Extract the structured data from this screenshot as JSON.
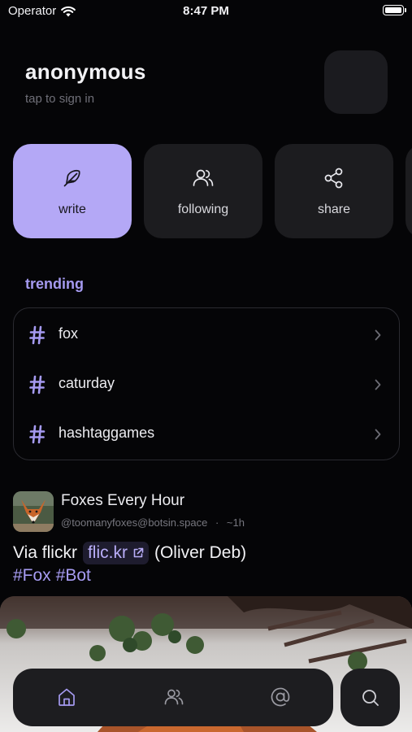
{
  "status_bar": {
    "carrier": "Operator",
    "time": "8:47 PM"
  },
  "profile": {
    "name": "anonymous",
    "subtitle": "tap to sign in"
  },
  "actions": [
    {
      "label": "write",
      "icon": "feather-icon",
      "active": true
    },
    {
      "label": "following",
      "icon": "users-icon",
      "active": false
    },
    {
      "label": "share",
      "icon": "share-icon",
      "active": false
    }
  ],
  "trending": {
    "title": "trending",
    "tags": [
      "fox",
      "caturday",
      "hashtaggames"
    ]
  },
  "post": {
    "author": "Foxes Every Hour",
    "handle": "@toomanyfoxes@botsin.space",
    "separator": "·",
    "time": "~1h",
    "text_prefix": "Via flickr",
    "link": "flic.kr",
    "text_suffix": "(Oliver Deb)",
    "tags": [
      "#Fox",
      "#Bot"
    ]
  },
  "tabbar": {
    "tabs": [
      "home-icon",
      "users-icon",
      "at-sign-icon"
    ],
    "active": "home-icon",
    "search": "search-icon"
  },
  "colors": {
    "accent": "#b4a8f6",
    "accent_text": "#a59af0",
    "background": "#050507",
    "card": "#1c1c1f"
  }
}
